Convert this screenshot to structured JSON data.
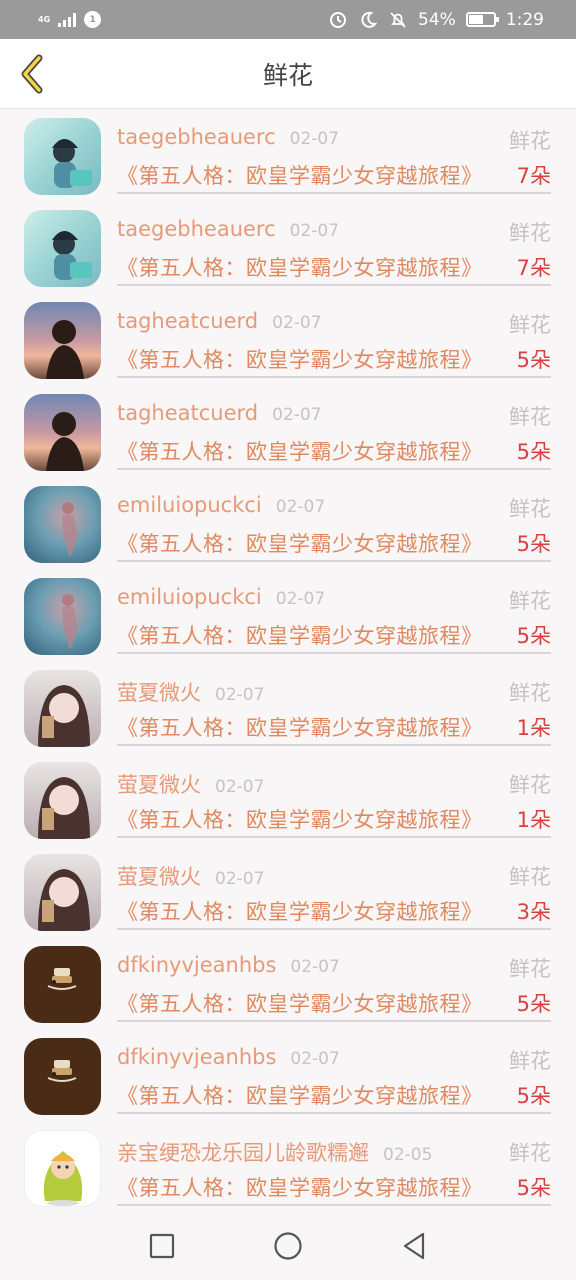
{
  "status_bar": {
    "network": "4G",
    "badge": "1",
    "battery_percent": "54%",
    "time": "1:29"
  },
  "header": {
    "title": "鲜花"
  },
  "records": [
    {
      "name": "taegebheauerc",
      "date": "02-07",
      "type": "鲜花",
      "book": "《第五人格：欧皇学霸少女穿越旅程》",
      "count": "7朵",
      "avatar": "av-a"
    },
    {
      "name": "taegebheauerc",
      "date": "02-07",
      "type": "鲜花",
      "book": "《第五人格：欧皇学霸少女穿越旅程》",
      "count": "7朵",
      "avatar": "av-a"
    },
    {
      "name": "tagheatcuerd",
      "date": "02-07",
      "type": "鲜花",
      "book": "《第五人格：欧皇学霸少女穿越旅程》",
      "count": "5朵",
      "avatar": "av-b"
    },
    {
      "name": "tagheatcuerd",
      "date": "02-07",
      "type": "鲜花",
      "book": "《第五人格：欧皇学霸少女穿越旅程》",
      "count": "5朵",
      "avatar": "av-b"
    },
    {
      "name": "emiluiopuckci",
      "date": "02-07",
      "type": "鲜花",
      "book": "《第五人格：欧皇学霸少女穿越旅程》",
      "count": "5朵",
      "avatar": "av-c"
    },
    {
      "name": "emiluiopuckci",
      "date": "02-07",
      "type": "鲜花",
      "book": "《第五人格：欧皇学霸少女穿越旅程》",
      "count": "5朵",
      "avatar": "av-c"
    },
    {
      "name": "萤夏微火",
      "date": "02-07",
      "type": "鲜花",
      "book": "《第五人格：欧皇学霸少女穿越旅程》",
      "count": "1朵",
      "avatar": "av-d"
    },
    {
      "name": "萤夏微火",
      "date": "02-07",
      "type": "鲜花",
      "book": "《第五人格：欧皇学霸少女穿越旅程》",
      "count": "1朵",
      "avatar": "av-d"
    },
    {
      "name": "萤夏微火",
      "date": "02-07",
      "type": "鲜花",
      "book": "《第五人格：欧皇学霸少女穿越旅程》",
      "count": "3朵",
      "avatar": "av-d"
    },
    {
      "name": "dfkinyvjeanhbs",
      "date": "02-07",
      "type": "鲜花",
      "book": "《第五人格：欧皇学霸少女穿越旅程》",
      "count": "5朵",
      "avatar": "av-e"
    },
    {
      "name": "dfkinyvjeanhbs",
      "date": "02-07",
      "type": "鲜花",
      "book": "《第五人格：欧皇学霸少女穿越旅程》",
      "count": "5朵",
      "avatar": "av-e"
    },
    {
      "name": "亲宝绠恐龙乐园儿龄歌糯邂",
      "date": "02-05",
      "type": "鲜花",
      "book": "《第五人格：欧皇学霸少女穿越旅程》",
      "count": "5朵",
      "avatar": "av-f"
    }
  ],
  "icons": {
    "back": "chevron-left-icon",
    "nav": [
      "square-icon",
      "circle-icon",
      "triangle-back-icon"
    ]
  },
  "colors": {
    "accent_orange": "#e0895f",
    "count_red": "#d9413f",
    "back_arrow": "#f3d34a"
  }
}
